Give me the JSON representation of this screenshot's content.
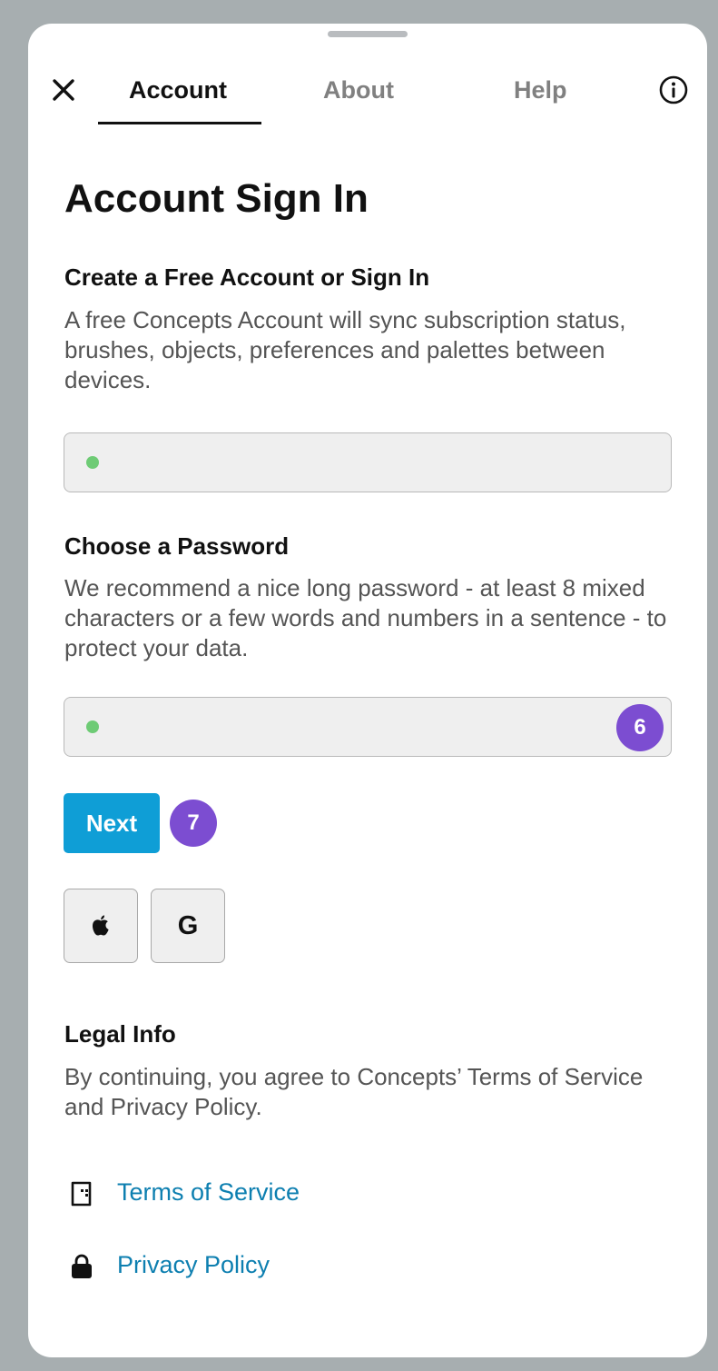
{
  "tabs": {
    "account": "Account",
    "about": "About",
    "help": "Help"
  },
  "icons": {
    "close": "close-icon",
    "info": "info-icon",
    "apple": "apple-icon",
    "terms": "document-icon",
    "privacy": "lock-icon"
  },
  "page_title": "Account Sign In",
  "account_section": {
    "heading": "Create a Free Account or Sign In",
    "description": "A free Concepts Account will sync subscription status, brushes, objects, preferences and palettes between devices.",
    "email_value": ""
  },
  "password_section": {
    "heading": "Choose a Password",
    "description": "We recommend a nice long password - at least 8 mixed characters or a few words and numbers in a sentence - to protect your data.",
    "password_value": "",
    "badge": "6"
  },
  "actions": {
    "next_label": "Next",
    "next_badge": "7",
    "google_label": "G"
  },
  "legal": {
    "heading": "Legal Info",
    "description": "By continuing, you agree to Concepts’ Terms of Service and Privacy Policy.",
    "terms_link": "Terms of Service",
    "privacy_link": "Privacy Policy"
  },
  "colors": {
    "accent_button": "#0f9ed6",
    "link": "#0d7fb0",
    "badge": "#7c4dd1",
    "field_indicator": "#6ecb75"
  }
}
